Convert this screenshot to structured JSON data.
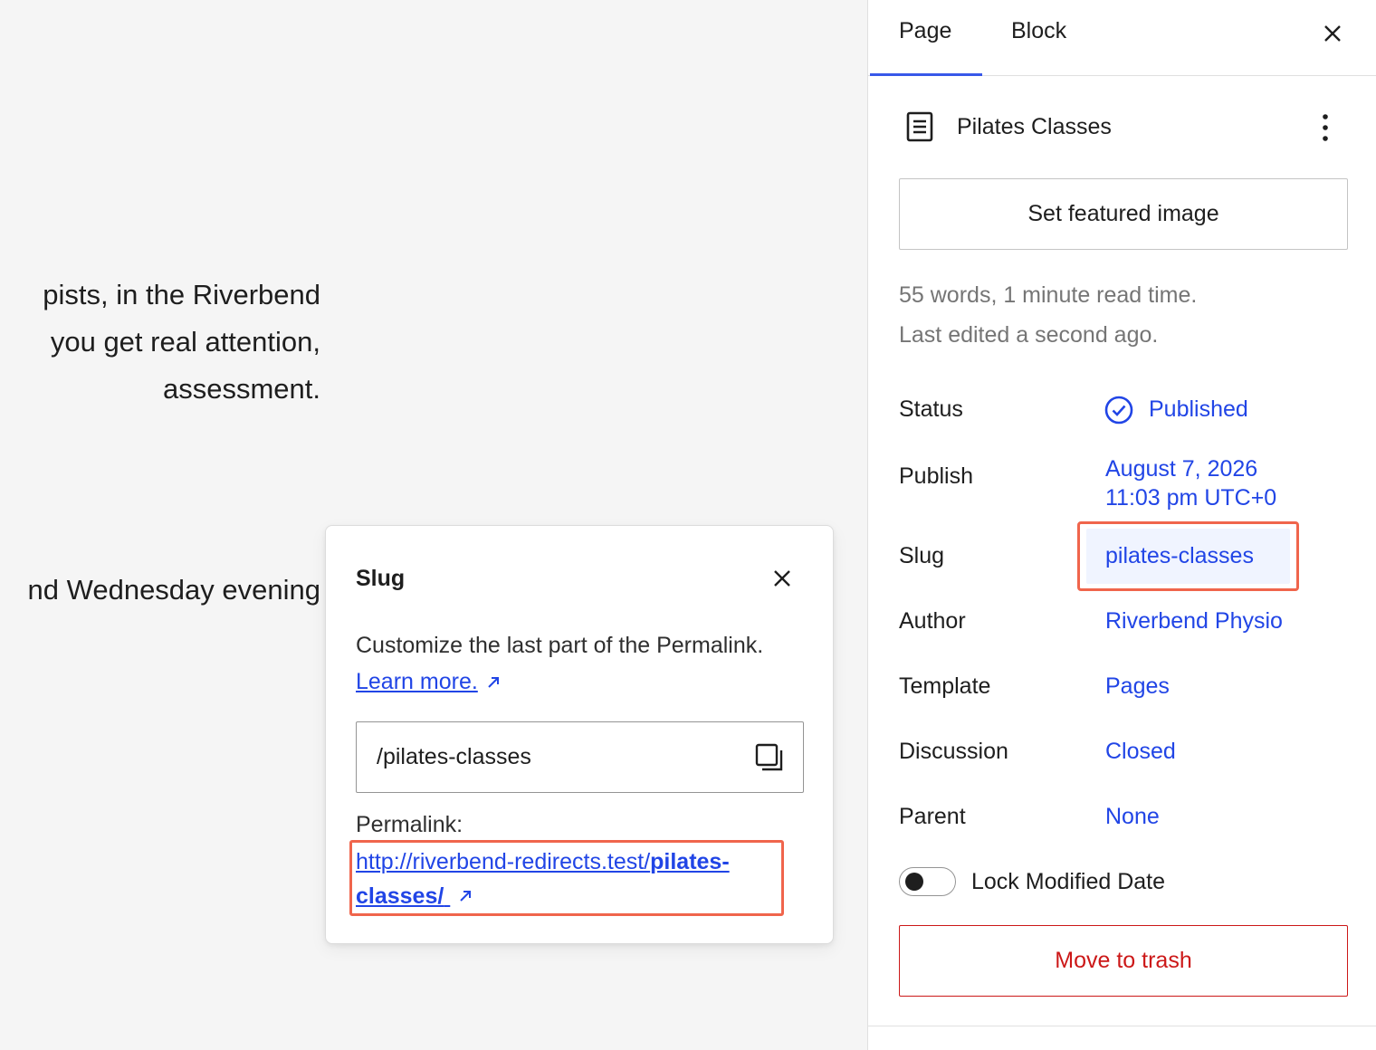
{
  "editor": {
    "paragraph1": [
      "pists, in the Riverbend",
      "you get real attention,",
      "assessment."
    ],
    "paragraph2": "nd Wednesday evening"
  },
  "popover": {
    "title": "Slug",
    "description": "Customize the last part of the Permalink.",
    "learn_more": "Learn more.",
    "slug_value": "/pilates-classes",
    "permalink_label": "Permalink:",
    "permalink_base": "http://riverbend-redirects.test/",
    "permalink_slug_part1": "pilates-",
    "permalink_slug_part2": "classes/",
    "icons": {
      "close": "close-icon",
      "copy": "copy-icon",
      "external": "external-link-icon"
    }
  },
  "sidebar": {
    "tabs": [
      {
        "label": "Page",
        "active": true
      },
      {
        "label": "Block",
        "active": false
      }
    ],
    "page_title": "Pilates Classes",
    "featured_image_label": "Set featured image",
    "word_count": "55 words, 1 minute read time.",
    "last_edited": "Last edited a second ago.",
    "rows": {
      "status": {
        "label": "Status",
        "value": "Published"
      },
      "publish": {
        "label": "Publish",
        "value_line1": "August 7, 2026",
        "value_line2": "11:03 pm UTC+0"
      },
      "slug": {
        "label": "Slug",
        "value": "pilates-classes"
      },
      "author": {
        "label": "Author",
        "value": "Riverbend Physio"
      },
      "template": {
        "label": "Template",
        "value": "Pages"
      },
      "discussion": {
        "label": "Discussion",
        "value": "Closed"
      },
      "parent": {
        "label": "Parent",
        "value": "None"
      }
    },
    "lock_modified_label": "Lock Modified Date",
    "lock_modified_on": false,
    "trash_label": "Move to trash"
  },
  "colors": {
    "accent": "#3858e9",
    "link": "#2145e6",
    "highlight": "#f0654c",
    "danger": "#cc1818"
  }
}
